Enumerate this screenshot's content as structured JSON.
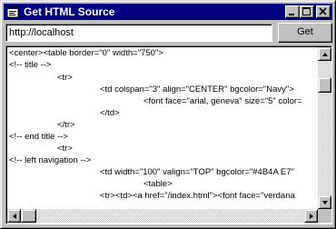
{
  "window": {
    "title": "Get HTML Source",
    "title_bar_color": "#000080",
    "icons": {
      "app": "app-window-icon",
      "minimize": "minimize-icon",
      "maximize": "maximize-icon",
      "close": "close-icon"
    }
  },
  "toolbar": {
    "url_value": "http://localhost",
    "get_label": "Get"
  },
  "source": {
    "lines": [
      "<center><table border=\"0\" width=\"750\">",
      "<!-- title -->",
      "<tr>",
      "<td colspan=\"3\" align=\"CENTER\" bgcolor=\"Navy\">",
      "<font face=\"arial, geneva\" size=\"5\" color=",
      "</td>",
      "</tr>",
      "<!-- end title -->",
      "<tr>",
      "<!-- left navigation -->",
      "<td width=\"100\" valign=\"TOP\" bgcolor=\"#4B4A E7\"",
      "<table>",
      "<tr><td><a href=\"/index.html\"><font face=\"verdana"
    ]
  },
  "scrollbars": {
    "vertical": {
      "up_icon": "scroll-up-arrow-icon",
      "down_icon": "scroll-down-arrow-icon",
      "position": 0.0
    },
    "horizontal": {
      "left_icon": "scroll-left-arrow-icon",
      "right_icon": "scroll-right-arrow-icon",
      "position": 0.0
    }
  }
}
